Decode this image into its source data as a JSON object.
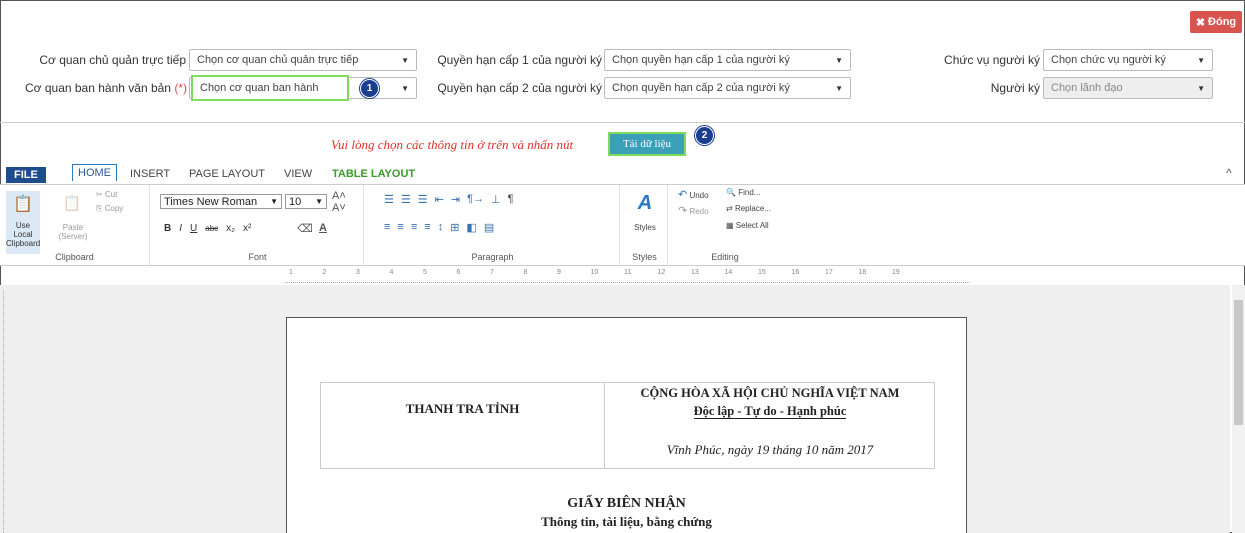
{
  "header": {
    "close_label": "Đóng"
  },
  "form": {
    "row1": {
      "parent_agency_label": "Cơ quan chủ quản trực tiếp",
      "parent_agency_value": "Chọn cơ quan chủ quản trực tiếp",
      "authority1_label": "Quyền hạn cấp 1 của người ký",
      "authority1_value": "Chọn quyền hạn cấp 1 của người ký",
      "position_label": "Chức vụ người ký",
      "position_value": "Chọn chức vụ người ký"
    },
    "row2": {
      "issuer_label": "Cơ quan ban hành văn bản",
      "issuer_required": "(*)",
      "issuer_value": "Chọn cơ quan ban hành",
      "authority2_label": "Quyền hạn cấp 2 của người ký",
      "authority2_value": "Chọn quyền hạn cấp 2 của người ký",
      "signer_label": "Người ký",
      "signer_value": "Chọn lãnh đạo"
    },
    "badge1": "1",
    "badge2": "2",
    "instruction": "Vui lòng chọn các thông tin ở trên và nhấn nút",
    "load_button": "Tải dữ liệu"
  },
  "ribbon": {
    "tabs": [
      "FILE",
      "HOME",
      "INSERT",
      "PAGE LAYOUT",
      "VIEW",
      "TABLE LAYOUT"
    ],
    "clipboard": {
      "use_local": "Use Local Clipboard",
      "paste": "Paste (Server)",
      "cut": "Cut",
      "copy": "Copy",
      "group": "Clipboard"
    },
    "font": {
      "family": "Times New Roman",
      "size": "10",
      "group": "Font"
    },
    "paragraph": {
      "group": "Paragraph"
    },
    "styles": {
      "label": "Styles",
      "group": "Styles"
    },
    "editing": {
      "undo": "Undo",
      "redo": "Redo",
      "find": "Find...",
      "replace": "Replace...",
      "select_all": "Select All",
      "group": "Editing"
    }
  },
  "ruler": [
    "1",
    "2",
    "3",
    "4",
    "5",
    "6",
    "7",
    "8",
    "9",
    "10",
    "11",
    "12",
    "13",
    "14",
    "15",
    "16",
    "17",
    "18",
    "19"
  ],
  "document": {
    "org": "THANH TRA TỈNH",
    "nation": "CỘNG HÒA XÃ HỘI CHỦ NGHĨA VIỆT NAM",
    "motto": "Độc lập - Tự do - Hạnh phúc",
    "place_date": "Vĩnh Phúc, ngày 19 tháng 10 năm 2017",
    "title": "GIẤY BIÊN NHẬN",
    "subtitle": "Thông tin, tài liệu, bằng chứng"
  },
  "colors": {
    "danger": "#d9534f",
    "highlight": "#7ddc5a",
    "badge": "#1b3f8f",
    "load_button": "#3aa0b8",
    "instruction": "#e0302a"
  }
}
